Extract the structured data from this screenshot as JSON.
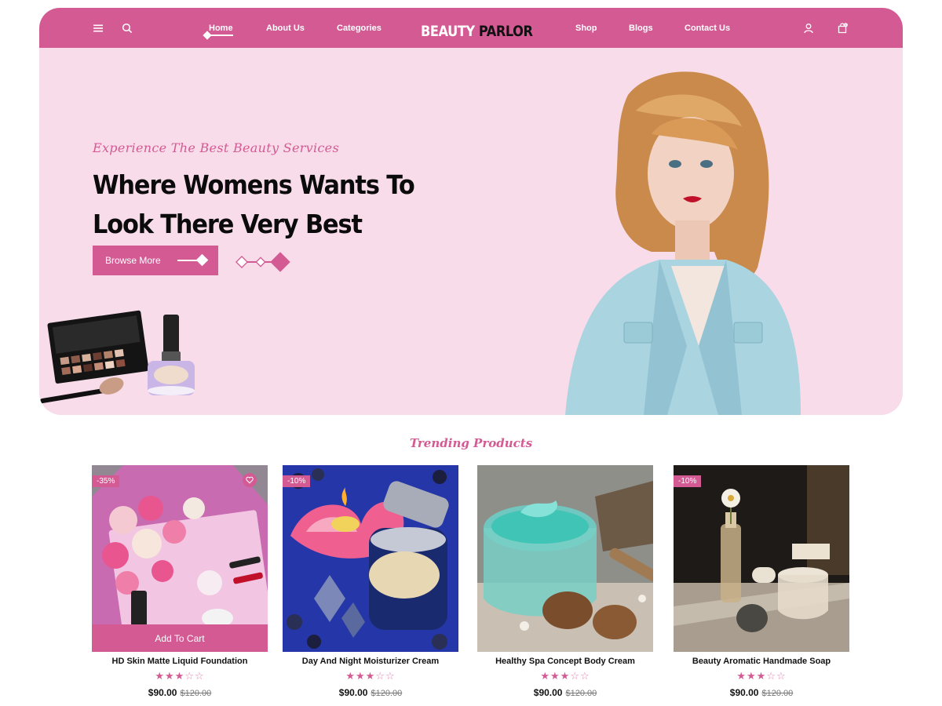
{
  "header": {
    "brand_part_1": "BEAUTY",
    "brand_part_2": "PARLOR",
    "cart_count": "0",
    "nav": [
      {
        "label": "Home",
        "active": true
      },
      {
        "label": "About Us"
      },
      {
        "label": "Categories"
      },
      {
        "label": "Shop"
      },
      {
        "label": "Blogs"
      },
      {
        "label": "Contact Us"
      }
    ],
    "icons": [
      "menu-icon",
      "search-icon",
      "user-icon",
      "cart-icon"
    ]
  },
  "hero": {
    "tagline": "Experience The Best Beauty Services",
    "title_line_1": "Where Womens Wants To",
    "title_line_2": "Look There Very Best",
    "button_label": "Browse More"
  },
  "trending": {
    "title": "Trending Products",
    "add_to_cart_label": "Add To Cart",
    "products": [
      {
        "name": "HD Skin Matte Liquid Foundation",
        "badge": "-35%",
        "rating": 3,
        "rating_max": 5,
        "price": "$90.00",
        "old_price": "$120.00",
        "wishlist": true,
        "hovered": true
      },
      {
        "name": "Day And Night Moisturizer Cream",
        "badge": "-10%",
        "rating": 3,
        "rating_max": 5,
        "price": "$90.00",
        "old_price": "$120.00"
      },
      {
        "name": "Healthy Spa Concept Body Cream",
        "badge": "",
        "rating": 3,
        "rating_max": 5,
        "price": "$90.00",
        "old_price": "$120.00"
      },
      {
        "name": "Beauty Aromatic Handmade Soap",
        "badge": "-10%",
        "rating": 3,
        "rating_max": 5,
        "price": "$90.00",
        "old_price": "$120.00"
      }
    ]
  },
  "colors": {
    "accent": "#d35a93",
    "hero_bg": "#f8dcea",
    "text_dark": "#0b0b0b"
  }
}
